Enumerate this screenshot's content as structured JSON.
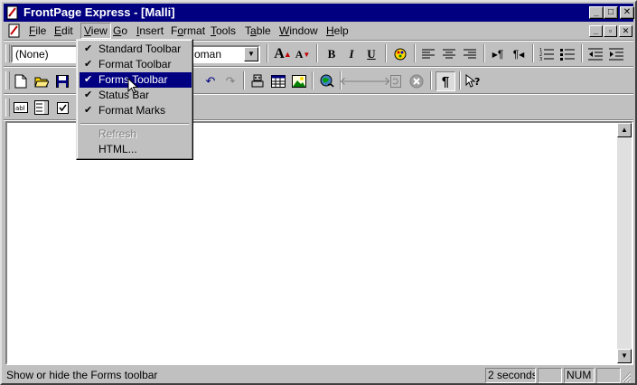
{
  "window": {
    "title": "FrontPage Express - [Malli]",
    "caption_buttons": [
      "_",
      "□",
      "✕"
    ],
    "mdi_buttons": [
      "_",
      "▫",
      "✕"
    ]
  },
  "menubar": {
    "items": [
      {
        "label": "File",
        "key": "F"
      },
      {
        "label": "Edit",
        "key": "E"
      },
      {
        "label": "View",
        "key": "V"
      },
      {
        "label": "Go",
        "key": "G"
      },
      {
        "label": "Insert",
        "key": "I"
      },
      {
        "label": "Format",
        "key": "o"
      },
      {
        "label": "Tools",
        "key": "T"
      },
      {
        "label": "Table",
        "key": "a"
      },
      {
        "label": "Window",
        "key": "W"
      },
      {
        "label": "Help",
        "key": "H"
      }
    ]
  },
  "format_toolbar": {
    "style_value": "(None)",
    "font_value": "oman",
    "bold": "B",
    "italic": "I",
    "underline": "U"
  },
  "view_menu": {
    "items": [
      {
        "label": "Standard Toolbar",
        "checked": true
      },
      {
        "label": "Format Toolbar",
        "checked": true
      },
      {
        "label": "Forms Toolbar",
        "checked": true,
        "highlighted": true
      },
      {
        "label": "Status Bar",
        "checked": true
      },
      {
        "label": "Format Marks",
        "checked": true
      }
    ],
    "items2": [
      {
        "label": "Refresh",
        "disabled": true
      },
      {
        "label": "HTML...",
        "disabled": false
      }
    ],
    "checkmark": "✔"
  },
  "status": {
    "message": "Show or hide the Forms toolbar",
    "time": "2 seconds",
    "num": "NUM"
  },
  "icons": {
    "paragraph": "¶"
  }
}
